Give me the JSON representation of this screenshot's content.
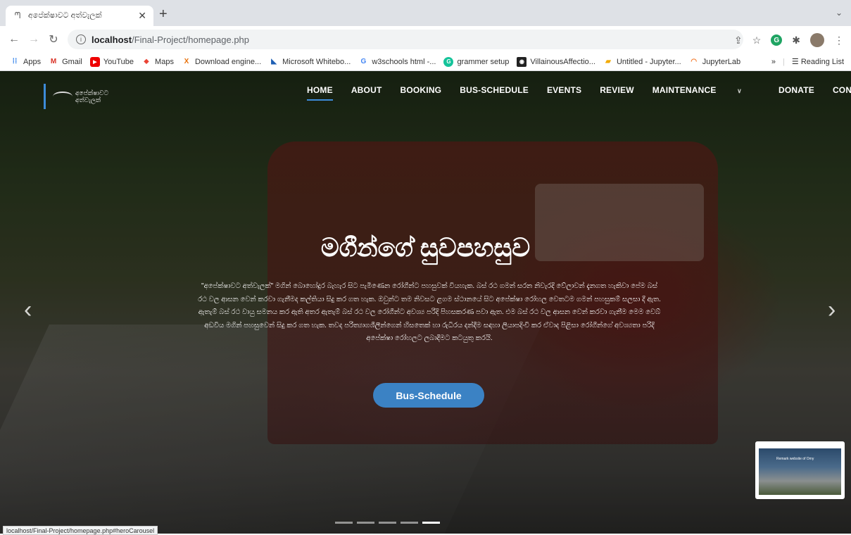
{
  "browser": {
    "tab_title": "අපේක්ෂාවට අත්වැලක්",
    "url_host": "localhost",
    "url_path": "/Final-Project/homepage.php",
    "status_url": "localhost/Final-Project/homepage.php#heroCarousel"
  },
  "bookmarks": {
    "items": [
      "Apps",
      "Gmail",
      "YouTube",
      "Maps",
      "Download engine...",
      "Microsoft Whitebo...",
      "w3schools html -...",
      "grammer setup",
      "VillainousAffectio...",
      "Untitled - Jupyter...",
      "JupyterLab"
    ],
    "overflow": "»",
    "reading_list": "Reading List"
  },
  "site": {
    "logo_text_line1": "අපේක්ෂාවට",
    "logo_text_line2": "අත්වැලක්",
    "nav": [
      "HOME",
      "ABOUT",
      "BOOKING",
      "BUS-SCHEDULE",
      "EVENTS",
      "REVIEW",
      "MAINTENANCE",
      "DONATE",
      "CONTACT"
    ],
    "active_nav": "HOME"
  },
  "hero": {
    "title": "මගීන්ගේ සුවපහසුව",
    "text": "\"අපේක්ෂාවට අත්වැලක්\" මගින් බොහෝදුර බැහැර සිට පැමිණෙන රෝගීන්ට පහසුවක් වියහැක. බස් රථ ගමන් සරන නිවැරදි වේලාවන් දැනගත හැකිවා පේම බස් රථ වල ආසන වෙන් කරවා ගැනීමද කල්තියා සිදු කර ගත හැක. ඔවුන්ට තම නිවසට ළගම ස්ථානයේ සිට අපේක්ෂා රෝහල වෙතටම ගමන් පහසුකම් සලසා දී ඇත. ඇතැම් බස් රථ වායු සමනය කර ඇති අතර ඇතැම් බස් රථ වල රෝගීන්ට අවශ්‍ය පරිදි පිහසකරණ පවා ඇත. එම බස් රථ වල ආසන වෙන් කරවා ගැනීම මෙම වෙබ් අඩවිය මගින් පහසුවෙන් සිදු කර ගත හැක. තවද පරිත්‍යාගශීලීන්ගෙන් හිසතෙක් හා රුධිරය දන්දීම සඳහා ලියාපදිංචි කර ඒවාද පිළිසා රෝගීන්ගේ අවශ්‍යතා පරිදි අපේක්ෂා රෝහලට ලබාදීමට කටයුතු කරයි.",
    "button": "Bus-Schedule",
    "slides": 5,
    "active_slide": 5
  },
  "thumbnail": {
    "caption": "Remark website of Omy"
  }
}
